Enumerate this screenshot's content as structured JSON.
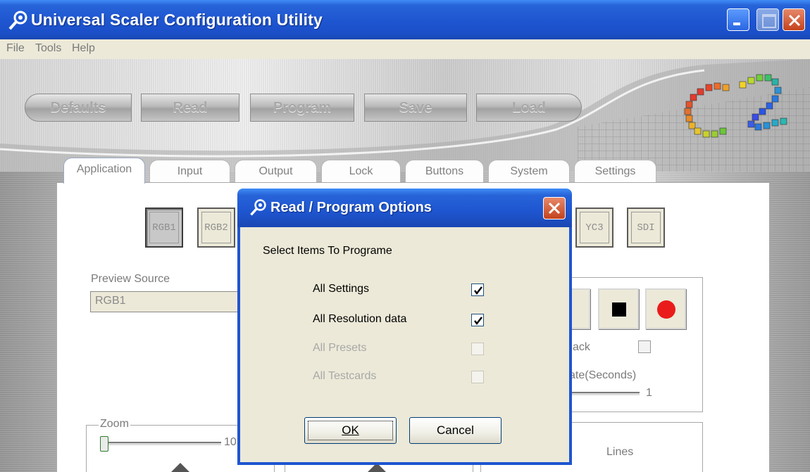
{
  "window": {
    "title": "Universal Scaler Configuration Utility"
  },
  "menu": [
    "File",
    "Tools",
    "Help"
  ],
  "toolbar": [
    "Defaults",
    "Read",
    "Program",
    "Save",
    "Load"
  ],
  "tabs": [
    "Application",
    "Input",
    "Output",
    "Lock",
    "Buttons",
    "System",
    "Settings"
  ],
  "sources": {
    "left": [
      "RGB1",
      "RGB2"
    ],
    "right": [
      "YC3",
      "SDI"
    ],
    "active": "RGB1"
  },
  "preview": {
    "label": "Preview Source",
    "value": "RGB1"
  },
  "background_text": {
    "ack": "ack",
    "rate": "ate(Seconds)",
    "rate_value": "1",
    "zoom": "Zoom",
    "zoom_value": "10",
    "lines": "Lines"
  },
  "dialog": {
    "title": "Read / Program Options",
    "heading": "Select Items To Programe",
    "options": [
      {
        "label": "All Settings",
        "checked": true,
        "enabled": true
      },
      {
        "label": "All Resolution data",
        "checked": true,
        "enabled": true
      },
      {
        "label": "All Presets",
        "checked": false,
        "enabled": false
      },
      {
        "label": "All Testcards",
        "checked": false,
        "enabled": false
      }
    ],
    "ok_label": "OK",
    "cancel_label": "Cancel"
  },
  "colors": {
    "title_blue": "#1e55d0",
    "dialog_face": "#ece9d8",
    "record_red": "#ea1b1b"
  }
}
